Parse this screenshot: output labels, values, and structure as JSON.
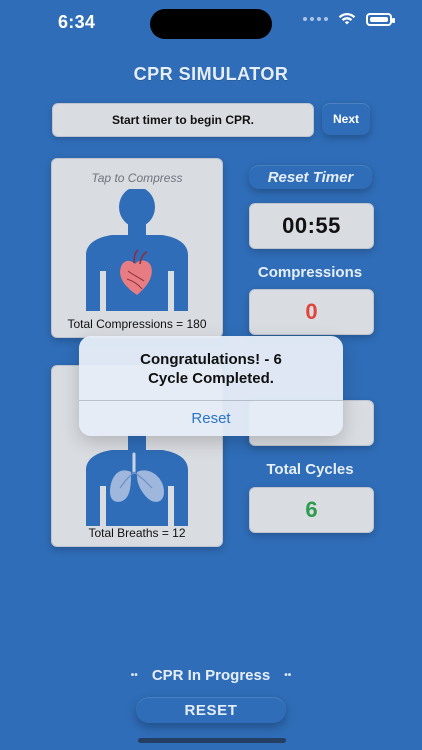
{
  "status": {
    "time": "6:34"
  },
  "app": {
    "title": "CPR SIMULATOR"
  },
  "instruction": {
    "text": "Start timer to begin CPR.",
    "next_label": "Next"
  },
  "compress_panel": {
    "tap_label": "Tap to Compress",
    "total_label": "Total Compressions = 180"
  },
  "breath_panel": {
    "total_label": "Total Breaths = 12"
  },
  "right_column": {
    "reset_timer_label": "Reset Timer",
    "timer_value": "00:55",
    "compressions_label": "Compressions",
    "compressions_value": "0",
    "breaths_value": "",
    "total_cycles_label": "Total Cycles",
    "total_cycles_value": "6"
  },
  "alert": {
    "line1": "Congratulations! - 6",
    "line2": "Cycle Completed.",
    "button_label": "Reset"
  },
  "bottom": {
    "status_text": "CPR In Progress",
    "reset_label": "RESET"
  },
  "colors": {
    "background": "#2F6DB8",
    "panel": "#D9DCE1",
    "accent_link": "#2B74CC",
    "compressions_value": "#E0443B",
    "cycles_value": "#2C9B4B"
  },
  "icons": {
    "heart": "heart-icon",
    "lungs": "lungs-icon",
    "wifi": "wifi-icon",
    "battery": "battery-icon"
  }
}
